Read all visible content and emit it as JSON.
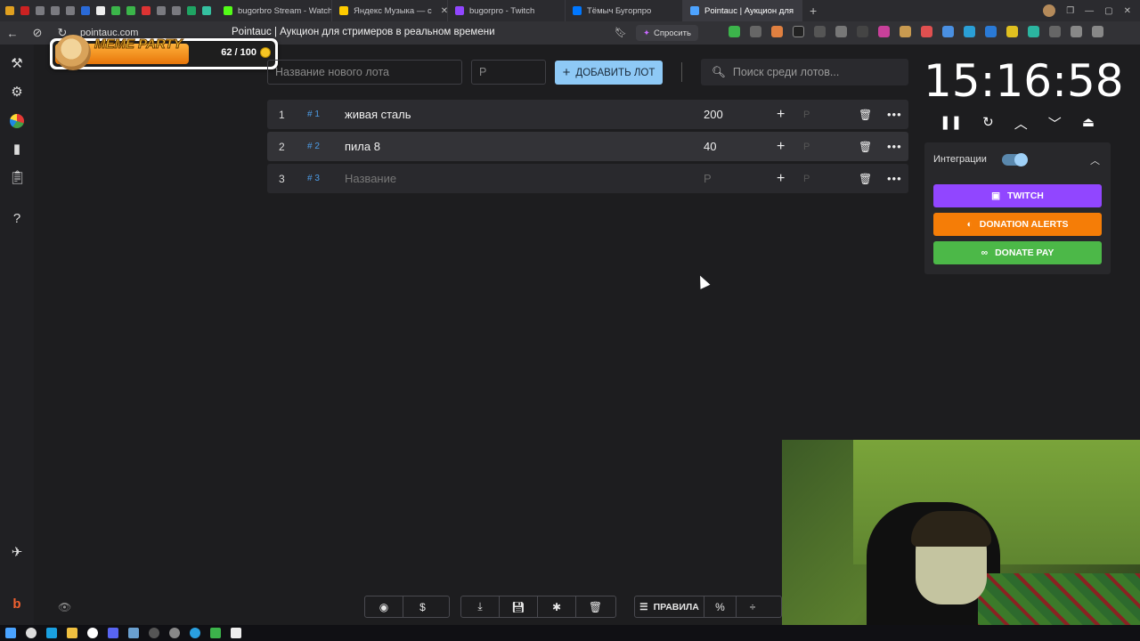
{
  "browser": {
    "tabs": [
      {
        "title": "bugorbro Stream - Watch",
        "color": "#53fc18"
      },
      {
        "title": "Яндекс Музыка — с",
        "color": "#ffcc00"
      },
      {
        "title": "bugorpro - Twitch",
        "color": "#9146ff"
      },
      {
        "title": "Тёмыч Бугорпро",
        "color": "#0077ff"
      },
      {
        "title": "Pointauc | Аукцион для",
        "color": "#4da3ff"
      }
    ],
    "url": "pointauc.com",
    "page_title": "Pointauc | Аукцион для стримеров в реальном времени",
    "ask_label": "Спросить"
  },
  "overlay": {
    "title": "MEME PARTY",
    "count": "62 / 100"
  },
  "toolbar": {
    "lot_name_placeholder": "Название нового лота",
    "amount_placeholder": "Р",
    "add_button": "ДОБАВИТЬ ЛОТ",
    "search_placeholder": "Поиск среди лотов..."
  },
  "lots": [
    {
      "num": "1",
      "id": "# 1",
      "name": "живая сталь",
      "amount": "200",
      "currency": "Р"
    },
    {
      "num": "2",
      "id": "# 2",
      "name": "пила 8",
      "amount": "40",
      "currency": "Р"
    },
    {
      "num": "3",
      "id": "# 3",
      "name": "Название",
      "amount": "Р",
      "currency": "Р"
    }
  ],
  "timer": {
    "value": "15:16:58"
  },
  "integrations": {
    "label": "Интеграции",
    "enabled": true,
    "buttons": [
      {
        "label": "TWITCH",
        "color": "#9146ff"
      },
      {
        "label": "DONATION ALERTS",
        "color": "#f57d07"
      },
      {
        "label": "DONATE PAY",
        "color": "#4cb848"
      }
    ]
  },
  "bottom": {
    "rules_label": "ПРАВИЛА",
    "percent_label": "%"
  }
}
